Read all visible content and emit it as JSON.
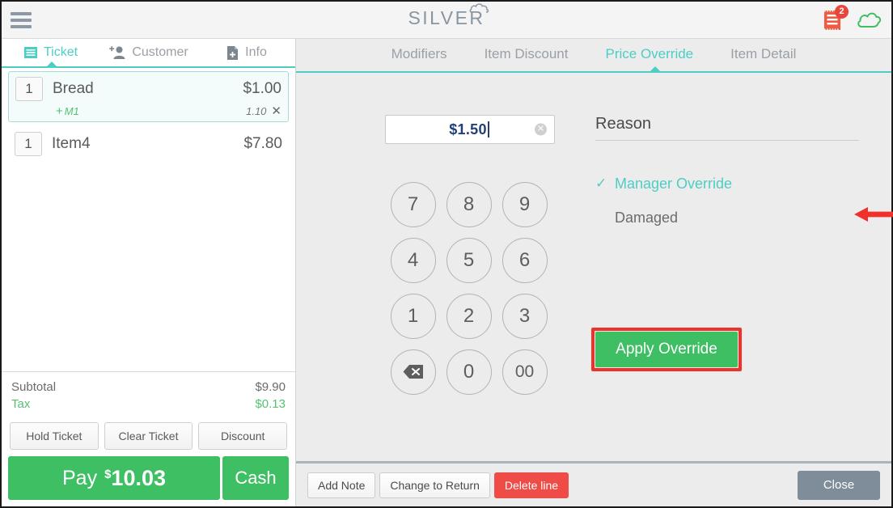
{
  "header": {
    "menu_icon": "hamburger-icon",
    "logo_text": "SILVER",
    "logo_cloud_icon": "cloud-icon",
    "receipt_icon": "receipt-icon",
    "receipt_badge_count": "2",
    "cloud_sync_icon": "cloud-icon",
    "accent_color": "#4ecdc4",
    "badge_color": "#e8453c",
    "receipt_color": "#ef5a41",
    "cloud_color": "#3fbf63"
  },
  "left_panel": {
    "tabs": [
      {
        "label": "Ticket",
        "icon": "ticket-icon",
        "active": true
      },
      {
        "label": "Customer",
        "icon": "add-person-icon",
        "active": false
      },
      {
        "label": "Info",
        "icon": "document-add-icon",
        "active": false
      }
    ],
    "items": [
      {
        "qty": "1",
        "name": "Bread",
        "price": "$1.00",
        "selected": true,
        "modifier": {
          "plus": "+",
          "name": "M1",
          "price": "1.10",
          "remove_icon": "close-icon"
        }
      },
      {
        "qty": "1",
        "name": "Item4",
        "price": "$7.80",
        "selected": false
      }
    ],
    "totals": [
      {
        "label": "Subtotal",
        "value": "$9.90",
        "highlight": false
      },
      {
        "label": "Tax",
        "value": "$0.13",
        "highlight": true
      }
    ],
    "action_buttons": [
      "Hold Ticket",
      "Clear Ticket",
      "Discount"
    ],
    "pay": {
      "label": "Pay",
      "currency": "$",
      "amount": "10.03",
      "cash_label": "Cash"
    }
  },
  "right_panel": {
    "tabs": [
      {
        "label": "Modifiers",
        "active": false
      },
      {
        "label": "Item Discount",
        "active": false
      },
      {
        "label": "Price Override",
        "active": true
      },
      {
        "label": "Item Detail",
        "active": false
      }
    ],
    "amount_input": {
      "value": "$1.50",
      "clear_icon": "clear-circle-icon"
    },
    "keypad": [
      {
        "label": "7",
        "kind": "digit"
      },
      {
        "label": "8",
        "kind": "digit"
      },
      {
        "label": "9",
        "kind": "digit"
      },
      {
        "label": "4",
        "kind": "digit"
      },
      {
        "label": "5",
        "kind": "digit"
      },
      {
        "label": "6",
        "kind": "digit"
      },
      {
        "label": "1",
        "kind": "digit"
      },
      {
        "label": "2",
        "kind": "digit"
      },
      {
        "label": "3",
        "kind": "digit"
      },
      {
        "label": "",
        "kind": "backspace"
      },
      {
        "label": "0",
        "kind": "digit"
      },
      {
        "label": "00",
        "kind": "digit"
      }
    ],
    "backspace_icon": "backspace-icon",
    "reason": {
      "title": "Reason",
      "options": [
        {
          "label": "Manager Override",
          "selected": true
        },
        {
          "label": "Damaged",
          "selected": false
        }
      ],
      "check_icon": "check-icon"
    },
    "apply_button": {
      "label": "Apply Override",
      "highlight_color": "#f0302a",
      "background_color": "#3fbf63"
    },
    "annotation": {
      "arrow_icon": "left-arrow-icon",
      "arrow_color": "#f0302a"
    }
  },
  "bottom_bar": {
    "buttons": [
      {
        "label": "Add Note",
        "style": "default"
      },
      {
        "label": "Change to Return",
        "style": "default"
      },
      {
        "label": "Delete line",
        "style": "danger"
      }
    ],
    "close_label": "Close"
  }
}
